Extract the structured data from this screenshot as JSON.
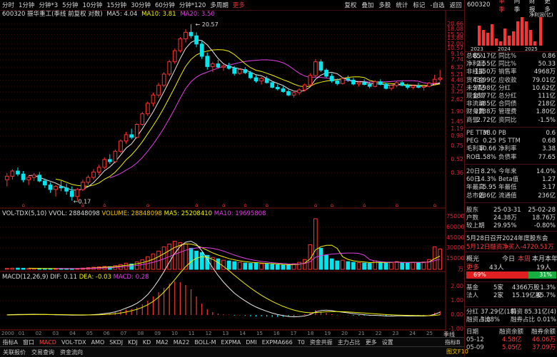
{
  "topbar": {
    "periods": [
      "分时",
      "1分钟",
      "分钟*3",
      "5分钟",
      "10分钟",
      "15分钟",
      "30分钟",
      "60分钟",
      "分钟*120",
      "多周期",
      "更多"
    ],
    "actions": [
      "复权",
      "叠加",
      "多股",
      "统计",
      "标记",
      "-自选",
      "返回"
    ]
  },
  "main_legend": {
    "title": "600320 振华重工(季线 前复权 对数)",
    "ma5": "MA5: 4.04",
    "ma10": "MA10: 3.81",
    "ma20": "MA20: 3.50"
  },
  "price_annot": {
    "high": "20.57",
    "low": "0.17"
  },
  "price_axis": [
    "20.66",
    "18.08",
    "15.50",
    "13.88",
    "12.00",
    "10.57",
    "9.16",
    "7.74",
    "6.32",
    "5.21",
    "4.48",
    "3.77",
    "3.25",
    "2.62",
    "1.90",
    "1.45",
    "1.19",
    "0.98",
    "0.75",
    "0.52",
    "0.36"
  ],
  "vol_legend": {
    "name": "VOL-TDX(5,10)",
    "vvol": "VVOL: 28848098",
    "volume": "VOLUME: 28848098",
    "ma5": "MA5: 25208410",
    "ma10": "MA10: 19695808"
  },
  "vol_axis": [
    "75000",
    "60000",
    "45000",
    "30000",
    "15000",
    "万"
  ],
  "macd_legend": {
    "name": "MACD(12,26,9)",
    "dif": "DIF: 0.11",
    "dea": "DEA: -0.03",
    "macd": "MACD: 0.28"
  },
  "macd_axis": [
    "2.00",
    "1.00",
    "0.00",
    "-1.00"
  ],
  "date_axis": [
    "2000",
    "01",
    "02",
    "03",
    "04",
    "05",
    "06",
    "07",
    "08",
    "09",
    "10",
    "11",
    "12",
    "13",
    "14",
    "15",
    "16",
    "17",
    "18",
    "19",
    "20",
    "21",
    "22",
    "23",
    "24",
    "25"
  ],
  "bottom_tabs1": [
    "指标A",
    "窗口",
    "MACD",
    "VOL-TDX",
    "AMO",
    "SKDJ",
    "KDJ",
    "KD",
    "MA2",
    "MA22",
    "BOLL-M",
    "EXPMA",
    "DMI",
    "EXPMA666",
    "T0",
    "资金共振",
    "主力占比",
    "更多",
    "设置"
  ],
  "bottom_tabs1_active": "MACD",
  "bottom_right_label": "指标B",
  "bottom_tabs2": [
    "关联报价",
    "交易查询",
    "资金流向"
  ],
  "right_panel": {
    "code": "600320",
    "tabs": [
      "单季",
      "同季",
      "财报",
      "更多"
    ],
    "mini_chart": {
      "title": "净利润(亿)",
      "years": [
        "2023",
        "2024",
        "2025"
      ]
    },
    "fin_rows": [
      [
        "总收入",
        "85.17亿",
        "同比%",
        "0.86"
      ],
      [
        "净利润",
        "2.55亿",
        "同比%",
        "50.33"
      ],
      [
        "非经损",
        "-1350万",
        "销售率",
        "4968万"
      ],
      [
        "货币金",
        "43.99亿",
        "应收款",
        "79.01亿"
      ],
      [
        "未分配",
        "37.98亿",
        "分红",
        "10.62亿"
      ],
      [
        "现金流",
        "18.77亿",
        "总分红",
        "111亿"
      ],
      [
        "非流动",
        "385亿",
        "合同债",
        "218亿"
      ],
      [
        "财务费",
        "2288万",
        "管理费",
        "1.80亿"
      ],
      [
        "商誉",
        "2.72亿",
        "资同比",
        "-1.5%"
      ]
    ],
    "val_rows": [
      [
        "PE TTM",
        "38.0",
        "PB",
        "0.6"
      ],
      [
        "PEG",
        "0.25",
        "PS TTM",
        "0.68"
      ],
      [
        "毛利率",
        "10.66",
        "净利率",
        "3.38"
      ],
      [
        "ROE",
        "1.58%",
        "负债率",
        "77.65"
      ]
    ],
    "perf_rows": [
      [
        "20日",
        "8.2%",
        "今年来",
        "14.0%"
      ],
      [
        "60日",
        "14.3%",
        "Beta值",
        "1.27"
      ],
      [
        "年最高",
        "5.95",
        "年最低",
        "3.17"
      ],
      [
        "总市值",
        "236亿",
        "流通值",
        "236亿"
      ]
    ],
    "holder_rows": [
      [
        "股东",
        "25-03-31",
        "",
        "25-02-28"
      ],
      [
        "户数",
        "24.38万",
        "",
        "18.76万"
      ],
      [
        "较上期",
        "29.95%",
        "",
        "-0.80%"
      ]
    ],
    "news1": "5月28日召开2024年度股东会",
    "news2": "5月12日融资净买入-4720.51万",
    "sector_row": {
      "name": "概光",
      "today": "今日",
      "week": "本周",
      "month": "本月",
      "year": "本年"
    },
    "sector_row2": {
      "label": "更多",
      "count": "43人",
      "count2": "19人"
    },
    "bull_pct": "69%",
    "bear_pct": "31%",
    "fund_rows": [
      [
        "基金",
        "5家",
        "4366万股",
        "1.3%"
      ],
      [
        "法人",
        "2家",
        "15.19亿股",
        "45.7%"
      ],
      [
        "",
        ""
      ]
    ],
    "extra_rows": [
      [
        "分红",
        "37.29亿(18)",
        "募资",
        "85.31亿(4)"
      ],
      [
        "融资占比",
        "3.08%",
        "融券占比",
        "0.01%"
      ]
    ],
    "margin_header": [
      "日期",
      "融资余额",
      "融券余额"
    ],
    "margin_rows": [
      [
        "05-12",
        "4.58亿",
        "46.06万"
      ],
      [
        "05-09",
        "5.05亿",
        "37.09万"
      ]
    ],
    "footer_label": "季线",
    "footer_right": "图文F10"
  },
  "chart_data": {
    "type": "candlestick",
    "title": "600320 振华重工(季线 前复权 对数)",
    "note": "quarterly candles approximated; prices in yuan",
    "ohlc": [
      [
        0.3,
        0.36,
        0.25,
        0.33
      ],
      [
        0.33,
        0.4,
        0.3,
        0.38
      ],
      [
        0.38,
        0.42,
        0.33,
        0.35
      ],
      [
        0.35,
        0.38,
        0.28,
        0.3
      ],
      [
        0.3,
        0.34,
        0.26,
        0.32
      ],
      [
        0.32,
        0.36,
        0.29,
        0.34
      ],
      [
        0.34,
        0.37,
        0.28,
        0.29
      ],
      [
        0.29,
        0.31,
        0.24,
        0.26
      ],
      [
        0.26,
        0.28,
        0.21,
        0.23
      ],
      [
        0.23,
        0.26,
        0.19,
        0.25
      ],
      [
        0.25,
        0.29,
        0.22,
        0.24
      ],
      [
        0.24,
        0.27,
        0.2,
        0.22
      ],
      [
        0.22,
        0.25,
        0.17,
        0.19
      ],
      [
        0.19,
        0.24,
        0.17,
        0.23
      ],
      [
        0.23,
        0.3,
        0.22,
        0.28
      ],
      [
        0.28,
        0.34,
        0.26,
        0.32
      ],
      [
        0.32,
        0.4,
        0.3,
        0.37
      ],
      [
        0.37,
        0.45,
        0.34,
        0.42
      ],
      [
        0.42,
        0.55,
        0.4,
        0.52
      ],
      [
        0.52,
        0.6,
        0.46,
        0.49
      ],
      [
        0.49,
        0.68,
        0.47,
        0.65
      ],
      [
        0.65,
        0.9,
        0.62,
        0.86
      ],
      [
        0.86,
        1.1,
        0.8,
        1.02
      ],
      [
        1.02,
        1.2,
        0.9,
        0.95
      ],
      [
        0.95,
        1.4,
        0.92,
        1.35
      ],
      [
        1.35,
        1.9,
        1.3,
        1.8
      ],
      [
        1.8,
        2.5,
        1.7,
        2.4
      ],
      [
        2.4,
        3.2,
        2.2,
        3.0
      ],
      [
        3.0,
        4.2,
        2.8,
        3.9
      ],
      [
        3.9,
        5.6,
        3.7,
        5.3
      ],
      [
        5.3,
        7.8,
        5.0,
        7.4
      ],
      [
        7.4,
        10.6,
        7.0,
        10.0
      ],
      [
        10.0,
        14.5,
        9.5,
        13.8
      ],
      [
        13.8,
        18.0,
        12.5,
        16.5
      ],
      [
        16.5,
        20.57,
        14.0,
        15.0
      ],
      [
        15.0,
        16.5,
        11.0,
        12.0
      ],
      [
        12.0,
        13.0,
        8.0,
        8.6
      ],
      [
        8.6,
        9.5,
        6.0,
        6.5
      ],
      [
        6.5,
        7.4,
        5.6,
        7.0
      ],
      [
        7.0,
        7.8,
        6.2,
        6.4
      ],
      [
        6.4,
        6.9,
        5.8,
        6.6
      ],
      [
        6.6,
        7.2,
        6.0,
        6.2
      ],
      [
        6.2,
        6.6,
        5.1,
        5.4
      ],
      [
        5.4,
        6.2,
        5.2,
        6.0
      ],
      [
        6.0,
        6.4,
        5.3,
        5.5
      ],
      [
        5.5,
        5.8,
        4.6,
        4.8
      ],
      [
        4.8,
        5.2,
        4.2,
        4.4
      ],
      [
        4.4,
        4.9,
        4.0,
        4.7
      ],
      [
        4.7,
        5.0,
        4.1,
        4.2
      ],
      [
        4.2,
        4.4,
        3.6,
        3.7
      ],
      [
        3.7,
        4.0,
        3.4,
        3.55
      ],
      [
        3.55,
        3.8,
        3.2,
        3.3
      ],
      [
        3.3,
        3.5,
        2.9,
        3.0
      ],
      [
        3.0,
        3.4,
        2.8,
        3.2
      ],
      [
        3.2,
        3.6,
        3.0,
        3.45
      ],
      [
        3.45,
        4.1,
        3.3,
        3.95
      ],
      [
        3.95,
        5.4,
        3.8,
        5.1
      ],
      [
        5.1,
        8.0,
        4.9,
        7.4
      ],
      [
        7.4,
        7.9,
        5.6,
        5.9
      ],
      [
        5.9,
        6.2,
        4.8,
        5.0
      ],
      [
        5.0,
        5.4,
        4.2,
        4.4
      ],
      [
        4.4,
        4.7,
        3.9,
        4.1
      ],
      [
        4.1,
        4.9,
        4.0,
        4.7
      ],
      [
        4.7,
        5.1,
        4.3,
        4.5
      ],
      [
        4.5,
        4.8,
        3.9,
        4.05
      ],
      [
        4.05,
        4.4,
        3.8,
        4.2
      ],
      [
        4.2,
        4.6,
        3.9,
        4.0
      ],
      [
        4.0,
        4.3,
        3.6,
        3.8
      ],
      [
        3.8,
        4.5,
        3.7,
        4.3
      ],
      [
        4.3,
        4.6,
        3.9,
        4.0
      ],
      [
        4.0,
        4.2,
        3.5,
        3.6
      ],
      [
        3.6,
        4.0,
        3.4,
        3.9
      ],
      [
        3.9,
        4.4,
        3.7,
        4.2
      ],
      [
        4.2,
        4.4,
        3.8,
        3.9
      ],
      [
        3.9,
        4.1,
        3.5,
        3.7
      ],
      [
        3.7,
        4.0,
        3.5,
        3.85
      ],
      [
        3.85,
        4.2,
        3.6,
        3.7
      ],
      [
        3.7,
        3.9,
        3.4,
        3.8
      ],
      [
        3.8,
        4.3,
        3.7,
        4.15
      ],
      [
        4.15,
        5.2,
        3.95,
        4.6
      ],
      [
        4.6,
        5.95,
        4.3,
        4.76
      ]
    ],
    "volume": [
      1500,
      1700,
      1800,
      1600,
      1400,
      1300,
      1200,
      1100,
      1000,
      1200,
      1100,
      1000,
      900,
      1300,
      1800,
      2400,
      3000,
      3600,
      4200,
      3800,
      5200,
      6800,
      8800,
      7600,
      10500,
      13500,
      18000,
      22000,
      26000,
      32000,
      36000,
      40000,
      38000,
      36000,
      30000,
      26000,
      24000,
      20000,
      17000,
      15000,
      13000,
      12000,
      11000,
      10000,
      9000,
      8500,
      9500,
      8000,
      7500,
      7000,
      6500,
      6000,
      6500,
      8000,
      10000,
      14000,
      35000,
      72000,
      30000,
      20000,
      15000,
      12000,
      13000,
      11000,
      10000,
      9500,
      9000,
      8500,
      12000,
      10000,
      9000,
      10000,
      11000,
      9500,
      9000,
      10000,
      9500,
      10500,
      14000,
      32000,
      29000
    ],
    "macd": [
      0.02,
      0.03,
      0.03,
      0.02,
      0.02,
      0.02,
      0.01,
      0.0,
      -0.01,
      -0.01,
      -0.01,
      -0.01,
      -0.02,
      -0.01,
      0.0,
      0.02,
      0.04,
      0.06,
      0.1,
      0.12,
      0.18,
      0.28,
      0.38,
      0.42,
      0.55,
      0.75,
      1.0,
      1.3,
      1.6,
      1.9,
      2.2,
      2.35,
      2.3,
      2.1,
      1.8,
      1.3,
      0.8,
      0.4,
      0.2,
      0.1,
      0.05,
      0.02,
      -0.05,
      -0.02,
      -0.06,
      -0.1,
      -0.12,
      -0.1,
      -0.12,
      -0.15,
      -0.14,
      -0.13,
      -0.12,
      -0.08,
      -0.02,
      0.05,
      0.15,
      0.35,
      0.25,
      0.15,
      0.05,
      -0.02,
      0.0,
      -0.02,
      -0.05,
      -0.04,
      -0.05,
      -0.06,
      -0.02,
      -0.04,
      -0.06,
      -0.04,
      0.0,
      -0.02,
      -0.04,
      -0.02,
      -0.03,
      -0.02,
      0.02,
      0.15,
      0.28
    ]
  }
}
